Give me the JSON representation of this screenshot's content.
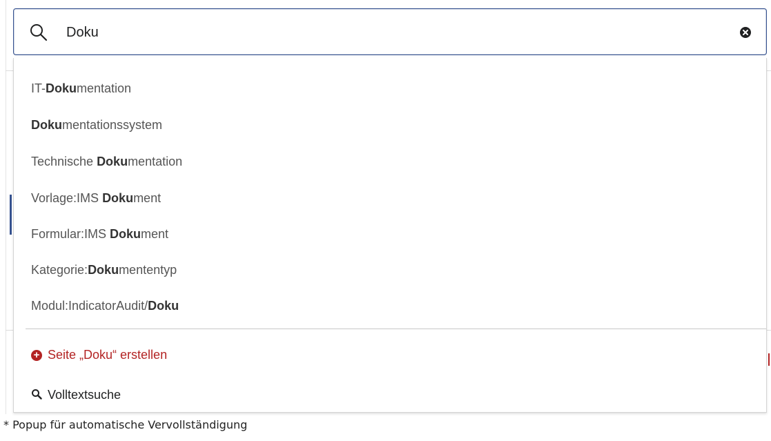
{
  "search": {
    "value": "Doku",
    "placeholder": ""
  },
  "suggestions": [
    {
      "before": "IT-",
      "match": "Doku",
      "after": "mentation"
    },
    {
      "before": "",
      "match": "Doku",
      "after": "mentationssystem"
    },
    {
      "before": "Technische ",
      "match": "Doku",
      "after": "mentation"
    },
    {
      "before": "Vorlage:IMS ",
      "match": "Doku",
      "after": "ment"
    },
    {
      "before": "Formular:IMS ",
      "match": "Doku",
      "after": "ment"
    },
    {
      "before": "Kategorie:",
      "match": "Doku",
      "after": "mententyp"
    },
    {
      "before": "Modul:IndicatorAudit/",
      "match": "Doku",
      "after": ""
    }
  ],
  "actions": {
    "create_page": "Seite „Doku“ erstellen",
    "fulltext_search": "Volltextsuche"
  },
  "caption": "* Popup für automatische Vervollständigung",
  "colors": {
    "accent": "#36528f",
    "create_link": "#b32424",
    "suggestion_text": "#555555"
  }
}
